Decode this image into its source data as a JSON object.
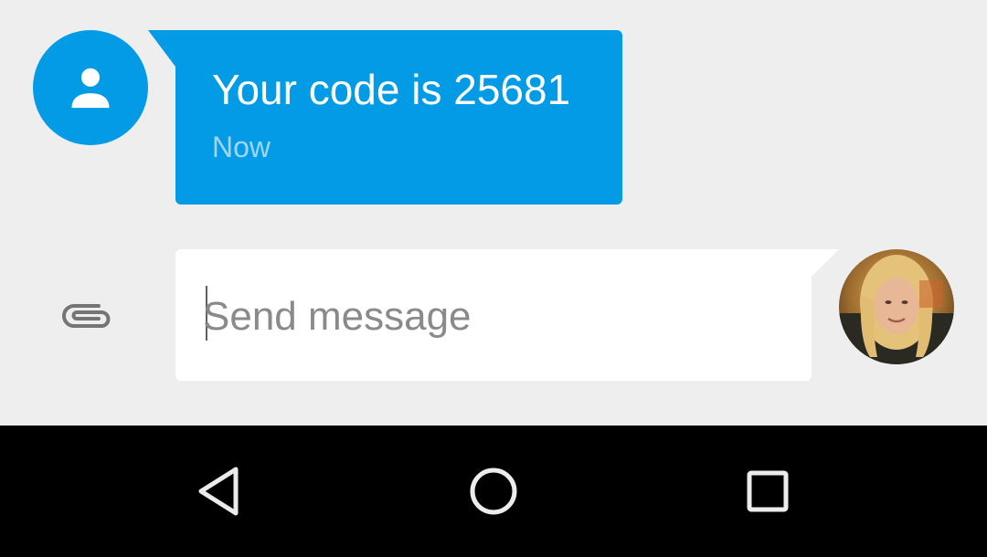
{
  "conversation": {
    "incoming": {
      "text": "Your code is 25681",
      "time": "Now",
      "avatar_icon": "person-icon"
    },
    "compose": {
      "placeholder": "Send message",
      "value": ""
    }
  },
  "nav": {
    "back_icon": "back-triangle-icon",
    "home_icon": "home-circle-icon",
    "recents_icon": "recents-square-icon"
  },
  "colors": {
    "accent": "#039be5",
    "background": "#eeeeee",
    "navbar": "#000000"
  }
}
